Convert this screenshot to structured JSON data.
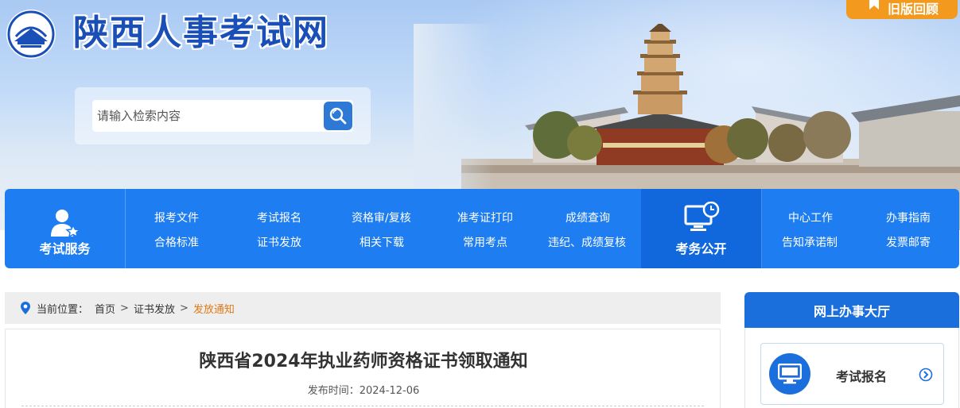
{
  "header": {
    "site_title": "陕西人事考试网",
    "old_version_label": "旧版回顾"
  },
  "search": {
    "placeholder": "请输入检索内容"
  },
  "nav": {
    "exam_service_label": "考试服务",
    "exam_affairs_label": "考务公开",
    "links": [
      "报考文件",
      "考试报名",
      "资格审/复核",
      "准考证打印",
      "成绩查询",
      "合格标准",
      "证书发放",
      "相关下载",
      "常用考点",
      "违纪、成绩复核",
      "中心工作",
      "办事指南",
      "告知承诺制",
      "发票邮寄"
    ]
  },
  "breadcrumb": {
    "prefix": "当前位置：",
    "items": [
      "首页",
      "证书发放",
      "发放通知"
    ]
  },
  "article": {
    "title": "陕西省2024年执业药师资格证书领取通知",
    "date_label": "发布时间：",
    "date": "2024-12-06"
  },
  "sidebar": {
    "title": "网上办事大厅",
    "card_label": "考试报名"
  },
  "colors": {
    "primary_blue": "#1e7df0",
    "dark_blue": "#1168dc",
    "accent_orange": "#f39a1e",
    "breadcrumb_current": "#e07a14"
  },
  "icons": [
    "emblem-icon",
    "bookmark-icon",
    "search-icon",
    "user-star-icon",
    "monitor-clock-icon",
    "location-pin-icon",
    "monitor-icon",
    "arrow-right-circle-icon"
  ]
}
